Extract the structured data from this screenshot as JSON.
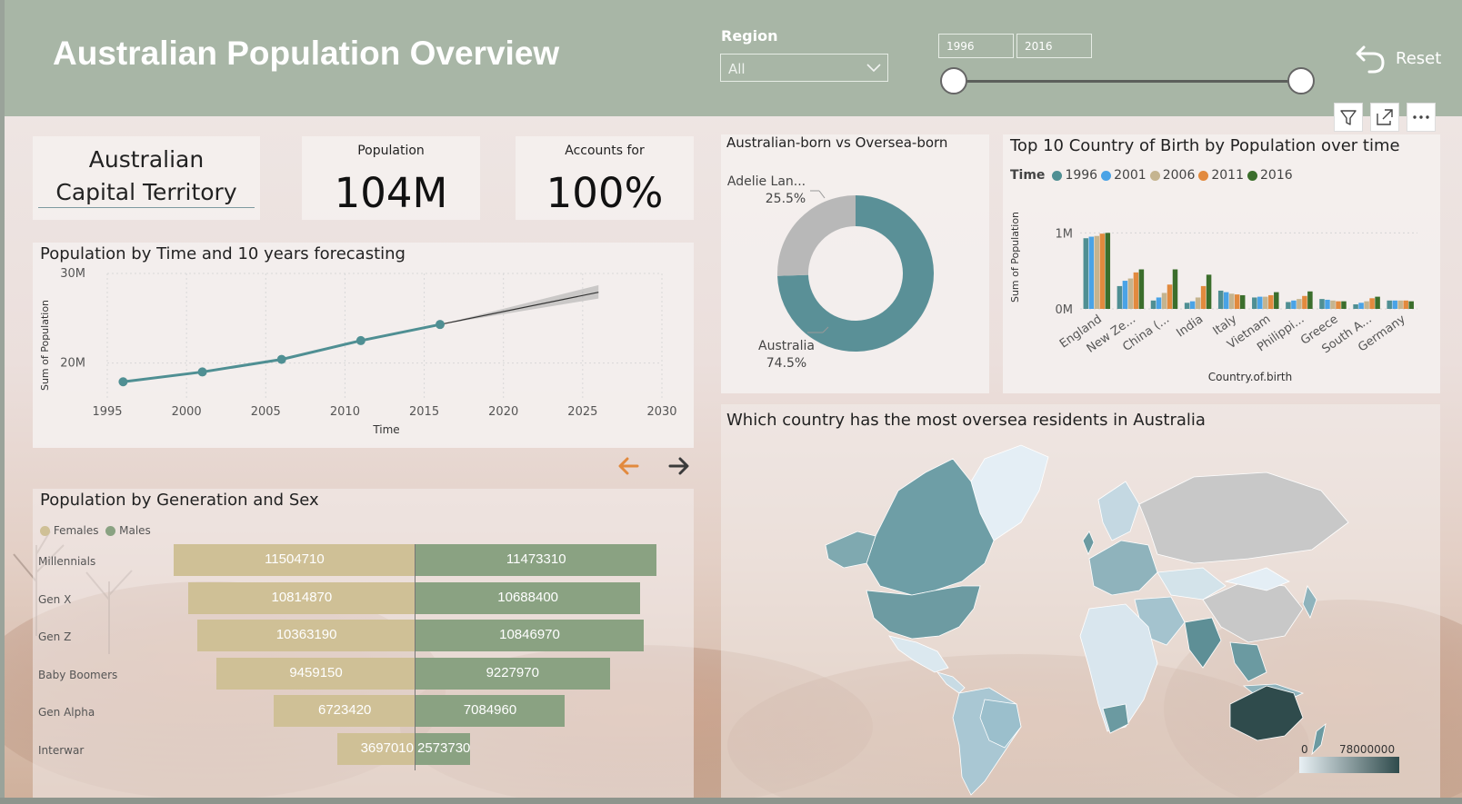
{
  "header": {
    "title": "Australian Population Overview",
    "region_label": "Region",
    "region_value": "All",
    "date_start": "1996",
    "date_end": "2016",
    "reset_label": "Reset",
    "bg_color": "#a8b6a6"
  },
  "kpi": {
    "region_name": "Australian Capital Territory",
    "population_label": "Population",
    "population_value": "104M",
    "accounts_label": "Accounts for",
    "accounts_value": "100%"
  },
  "line_chart": {
    "title": "Population by Time and 10 years forecasting",
    "chart_data": {
      "type": "line",
      "xlabel": "Time",
      "ylabel": "Sum of Population",
      "x_ticks": [
        1995,
        2000,
        2005,
        2010,
        2015,
        2020,
        2025,
        2030
      ],
      "y_ticks": [
        {
          "v": 20000000,
          "label": "20M"
        },
        {
          "v": 30000000,
          "label": "30M"
        }
      ],
      "xlim": [
        1995,
        2030
      ],
      "ylim": [
        16000000,
        30000000
      ],
      "series": [
        {
          "x": [
            1996,
            2001,
            2006,
            2011,
            2016
          ],
          "y": [
            17900000,
            19000000,
            20400000,
            22500000,
            24300000
          ]
        }
      ],
      "forecast": {
        "x": [
          2016,
          2026
        ],
        "y": [
          24300000,
          27900000
        ],
        "lower": [
          24300000,
          27200000
        ],
        "upper": [
          24300000,
          28700000
        ]
      },
      "color": "#4f8f93"
    }
  },
  "donut": {
    "title": "Australian-born vs Oversea-born",
    "chart_data": {
      "type": "pie",
      "slices": [
        {
          "label": "Australia",
          "pct_label": "74.5%",
          "value": 74.5,
          "color": "#5a9097"
        },
        {
          "label": "Adelie Lan...",
          "pct_label": "25.5%",
          "value": 25.5,
          "color": "#b8b8b8"
        }
      ]
    }
  },
  "column_chart": {
    "title": "Top 10 Country of Birth by Population over time",
    "legend_title": "Time",
    "chart_data": {
      "type": "bar",
      "xlabel": "Country.of.birth",
      "ylabel": "Sum of Population",
      "y_ticks": [
        {
          "v": 0,
          "label": "0M"
        },
        {
          "v": 1000000,
          "label": "1M"
        }
      ],
      "ylim": [
        0,
        1100000
      ],
      "categories": [
        "England",
        "New Ze...",
        "China (...",
        "India",
        "Italy",
        "Vietnam",
        "Philippi...",
        "Greece",
        "South A...",
        "Germany"
      ],
      "series": [
        {
          "name": "1996",
          "color": "#4f8f93",
          "values": [
            930000,
            300000,
            110000,
            80000,
            240000,
            150000,
            90000,
            130000,
            60000,
            110000
          ]
        },
        {
          "name": "2001",
          "color": "#4aa3e6",
          "values": [
            950000,
            370000,
            150000,
            100000,
            220000,
            160000,
            110000,
            120000,
            80000,
            110000
          ]
        },
        {
          "name": "2006",
          "color": "#c5b48f",
          "values": [
            960000,
            400000,
            210000,
            150000,
            200000,
            160000,
            130000,
            110000,
            100000,
            110000
          ]
        },
        {
          "name": "2011",
          "color": "#e28a3e",
          "values": [
            990000,
            480000,
            320000,
            300000,
            190000,
            180000,
            170000,
            100000,
            140000,
            110000
          ]
        },
        {
          "name": "2016",
          "color": "#3b6e2c",
          "values": [
            1000000,
            520000,
            520000,
            450000,
            180000,
            220000,
            230000,
            100000,
            160000,
            100000
          ]
        }
      ]
    }
  },
  "map": {
    "title": "Which country has the most oversea residents in Australia",
    "scale_min": "0",
    "scale_max": "78000000",
    "color_low": "#e8f0f4",
    "color_high": "#2f4b4c"
  },
  "pyramid": {
    "title": "Population by Generation and Sex",
    "legend": [
      {
        "label": "Females",
        "color": "#cfc096"
      },
      {
        "label": "Males",
        "color": "#8aa282"
      }
    ],
    "chart_data": {
      "type": "bar",
      "categories": [
        "Millennials",
        "Gen X",
        "Gen Z",
        "Baby Boomers",
        "Gen Alpha",
        "Interwar"
      ],
      "series": [
        {
          "name": "Females",
          "values": [
            11504710,
            10814870,
            10363190,
            9459150,
            6723420,
            3697010
          ]
        },
        {
          "name": "Males",
          "values": [
            11473310,
            10688400,
            10846970,
            9227970,
            7084960,
            2573730
          ]
        }
      ],
      "labels_f": [
        "11504710",
        "10814870",
        "10363190",
        "9459150",
        "6723420",
        "3697010"
      ],
      "labels_m": [
        "11473310",
        "10688400",
        "10846970",
        "9227970",
        "7084960",
        "2573730"
      ]
    }
  }
}
